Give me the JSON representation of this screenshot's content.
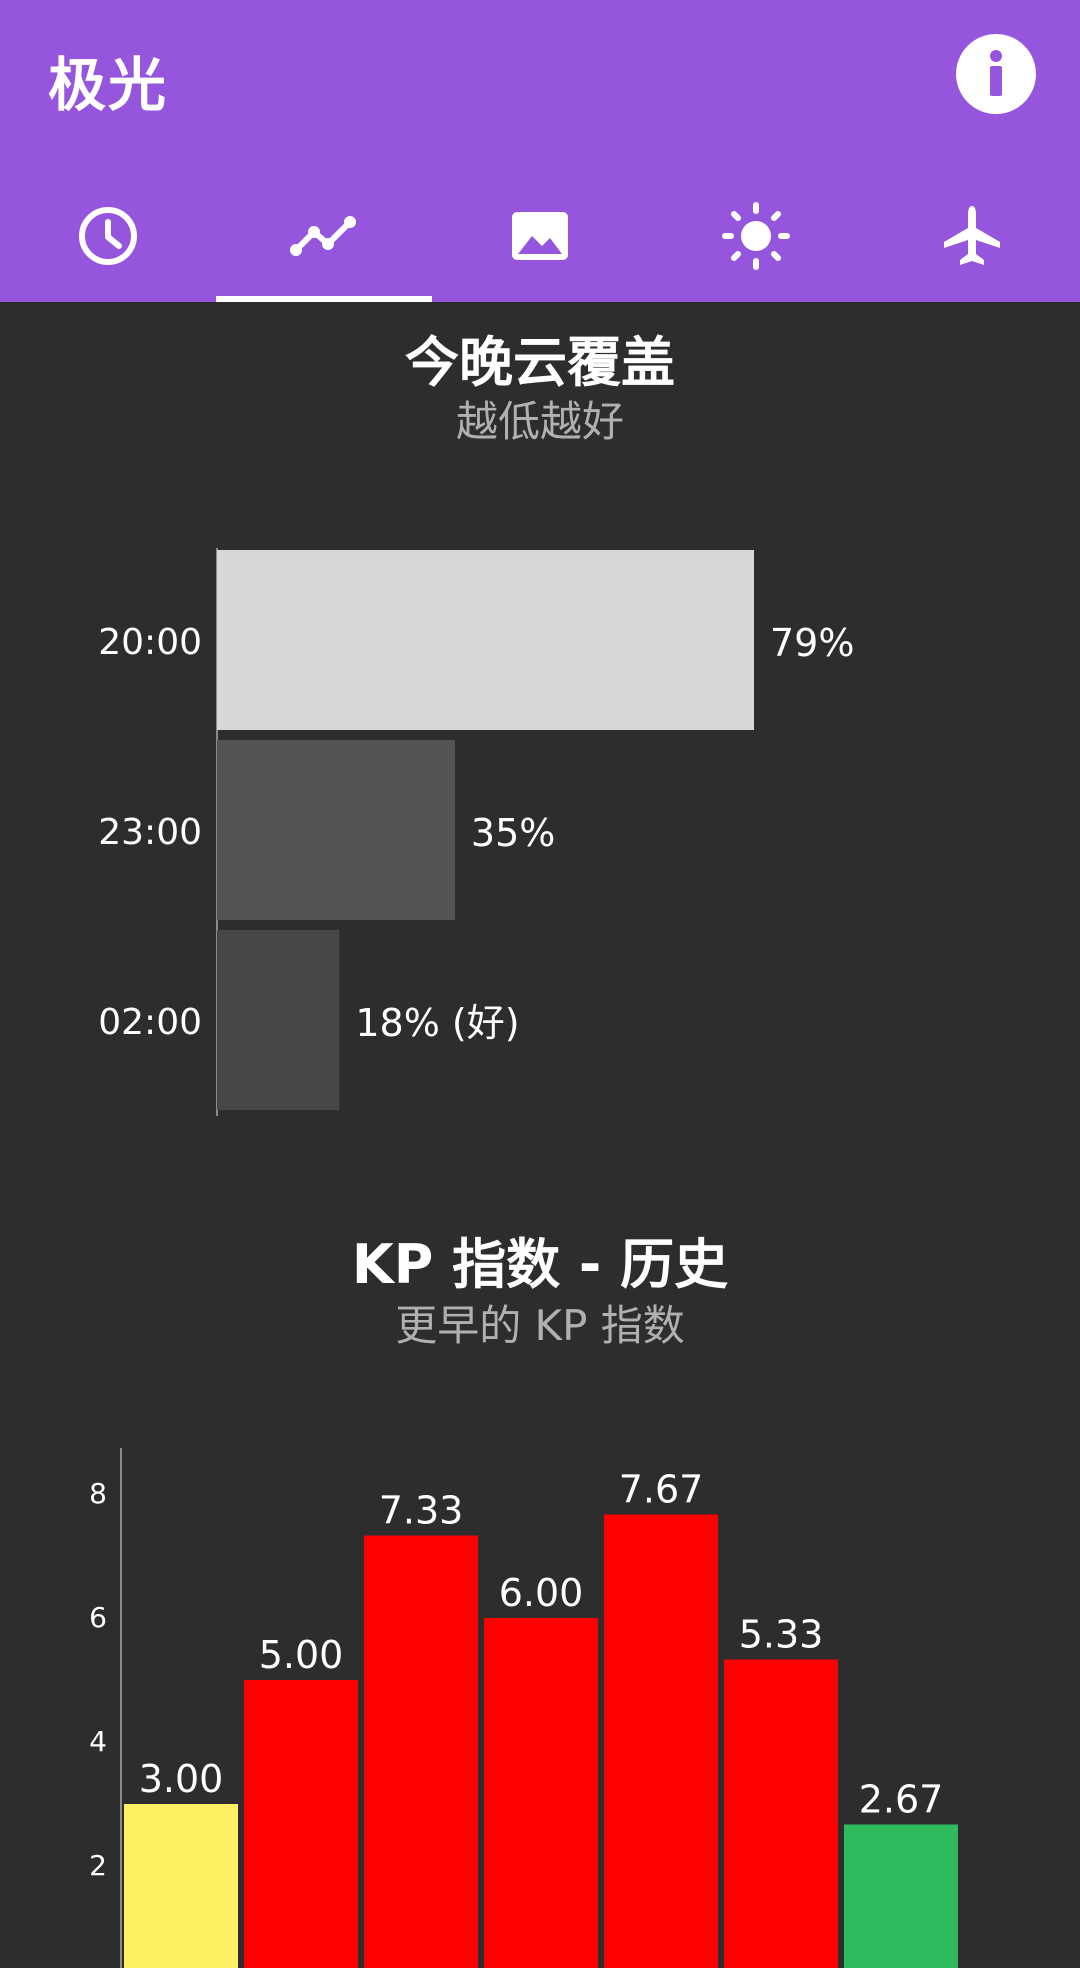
{
  "app": {
    "title": "极光"
  },
  "header": {
    "info_icon": "info-icon"
  },
  "tabs": [
    {
      "icon": "clock-icon",
      "selected": false
    },
    {
      "icon": "line-chart-icon",
      "selected": true
    },
    {
      "icon": "image-icon",
      "selected": false
    },
    {
      "icon": "sun-icon",
      "selected": false
    },
    {
      "icon": "airplane-icon",
      "selected": false
    }
  ],
  "colors": {
    "app_bar": "#9556dd",
    "background": "#2d2d2d",
    "kp_low": "#fff063",
    "kp_high": "#ff0000",
    "kp_good": "#2fba5e"
  },
  "cloud": {
    "title": "今晚云覆盖",
    "subtitle": "越低越好"
  },
  "kp": {
    "title": "KP 指数 - 历史",
    "subtitle": "更早的 KP 指数"
  },
  "chart_data": [
    {
      "type": "bar",
      "orientation": "horizontal",
      "categories": [
        "20:00",
        "23:00",
        "02:00"
      ],
      "values": [
        79,
        35,
        18
      ],
      "labels": [
        "79%",
        "35%",
        "18% (好)"
      ],
      "colors": [
        "#d8d8d8",
        "#545454",
        "#474747"
      ],
      "xlim": [
        0,
        100
      ]
    },
    {
      "type": "bar",
      "values": [
        3.0,
        5.0,
        7.33,
        6.0,
        7.67,
        5.33,
        2.67
      ],
      "labels": [
        "3.00",
        "5.00",
        "7.33",
        "6.00",
        "7.67",
        "5.33",
        "2.67"
      ],
      "colors": [
        "#fff063",
        "#ff0000",
        "#ff0000",
        "#ff0000",
        "#ff0000",
        "#ff0000",
        "#2fba5e"
      ],
      "yticks": [
        "2",
        "4",
        "6",
        "8"
      ],
      "ylim": [
        0,
        9
      ]
    }
  ]
}
